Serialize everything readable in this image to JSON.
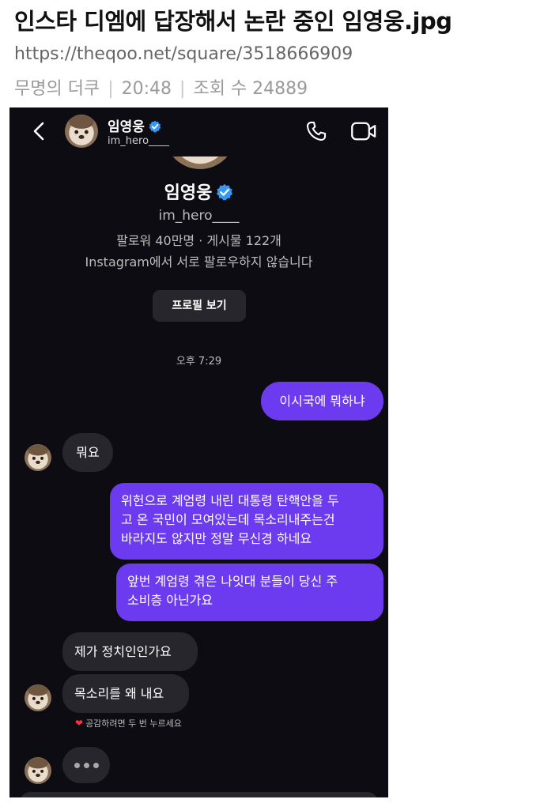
{
  "post": {
    "title": "인스타 디엠에 답장해서 논란 중인 임영웅.jpg",
    "url": "https://theqoo.net/square/3518666909",
    "author": "무명의 더쿠",
    "time": "20:48",
    "views_label": "조회 수",
    "views": "24889"
  },
  "dm": {
    "header": {
      "name": "임영웅",
      "handle": "im_hero____",
      "icons": [
        "back-chevron-icon",
        "verified-badge-icon",
        "phone-icon",
        "video-camera-icon"
      ]
    },
    "profile": {
      "name": "임영웅",
      "handle": "im_hero____",
      "stats": "팔로워 40만명 · 게시물 122개",
      "follow_status": "Instagram에서 서로 팔로우하지 않습니다",
      "view_profile_label": "프로필 보기"
    },
    "timestamp": "오후 7:29",
    "messages": [
      {
        "side": "sent",
        "lines": [
          "이시국에 뭐하냐"
        ]
      },
      {
        "side": "received",
        "lines": [
          "뭐요"
        ]
      },
      {
        "side": "sent",
        "lines": [
          "위헌으로 계엄령 내린 대통령 탄핵안을 두",
          "고 온 국민이 모여있는데 목소리내주는건",
          "바라지도 않지만 정말 무신경 하네요"
        ]
      },
      {
        "side": "sent",
        "lines": [
          "앞번 계엄령 겪은 나잇대 분들이 당신 주",
          "소비층 아닌가요"
        ]
      },
      {
        "side": "received",
        "lines": [
          "제가 정치인인가요"
        ]
      },
      {
        "side": "received",
        "lines": [
          "목소리를 왜 내요"
        ]
      }
    ],
    "reaction_hint": "공감하려면 두 번 누르세요",
    "colors": {
      "background": "#0c0c12",
      "sent_bubble": "#6c3bf0",
      "received_bubble": "#26262c",
      "verified": "#3897f0",
      "heart": "#ff3040"
    }
  }
}
